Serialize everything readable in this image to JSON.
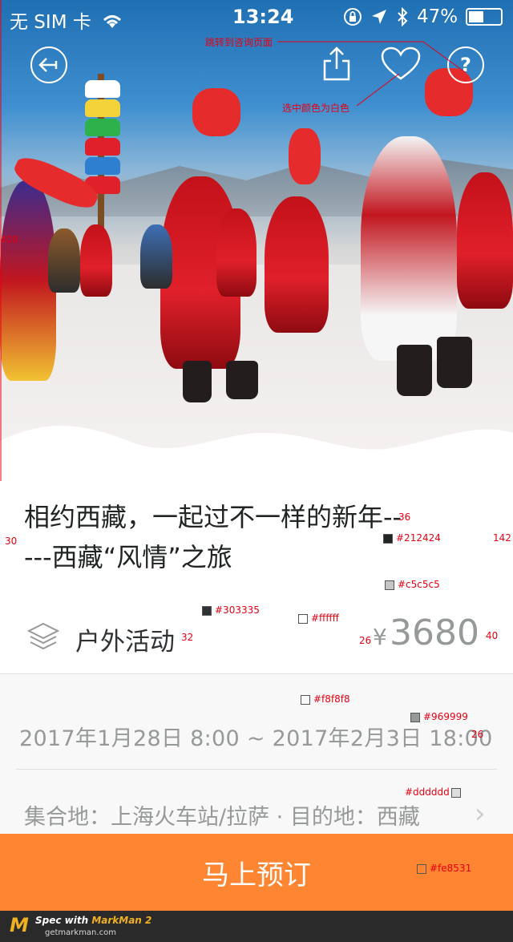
{
  "status_bar": {
    "carrier": "无 SIM 卡",
    "time": "13:24",
    "battery": "47%",
    "battery_level": 0.47
  },
  "annotations": {
    "jump_to_consult": "跳转到咨询页面",
    "selected_white": "选中颜色为白色",
    "title_size": "36",
    "left_margin": "30",
    "block_height": "142",
    "color_title": "#212424",
    "color_border": "#c5c5c5",
    "color_label": "#303335",
    "label_size": "32",
    "color_white": "#ffffff",
    "currency_size": "26",
    "price_size": "40",
    "color_bg": "#f8f8f8",
    "color_gray": "#969999",
    "dates_size": "26",
    "color_divider": "#dddddd",
    "color_button": "#fe8531",
    "hero_height": "400"
  },
  "event": {
    "title": "相约西藏，一起过不一样的新年-----西藏“风情”之旅",
    "category": "户外活动",
    "currency": "¥",
    "price": "3680",
    "dates": "2017年1月28日 8:00 ~ 2017年2月3日 18:00",
    "meeting_point": "集合地：上海火车站/拉萨  ·  目的地：西藏"
  },
  "book_button": "马上预订",
  "footer": {
    "spec_with": "Spec with ",
    "markman": "MarkMan 2",
    "site": "getmarkman.com"
  },
  "colors": {
    "title": "#212424",
    "divider": "#c5c5c5",
    "label": "#303335",
    "secondary": "#969999",
    "background": "#f8f8f8",
    "accent": "#fe8531"
  },
  "icons": [
    "back-icon",
    "share-icon",
    "heart-icon",
    "help-icon",
    "layers-icon",
    "chevron-right-icon",
    "wifi-icon",
    "lock-icon",
    "location-icon",
    "bluetooth-icon"
  ]
}
